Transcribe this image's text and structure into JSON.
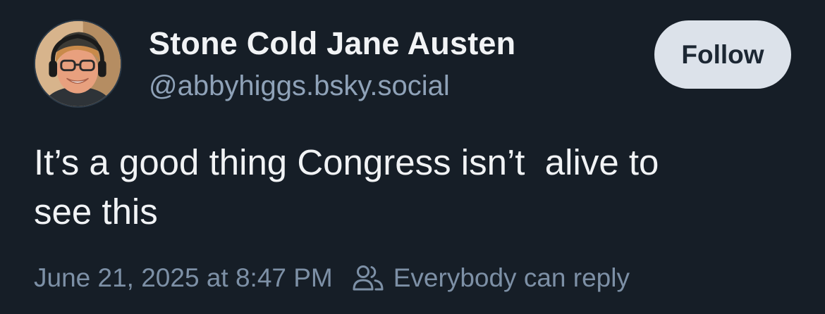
{
  "author": {
    "display_name": "Stone Cold Jane Austen",
    "handle": "@abbyhiggs.bsky.social",
    "avatar_icon": "user-avatar-photo"
  },
  "follow_button": {
    "label": "Follow"
  },
  "post": {
    "text": "It’s a good thing Congress isn’t  alive to\nsee this"
  },
  "meta": {
    "timestamp": "June 21, 2025 at 8:47 PM",
    "reply_setting": "Everybody can reply",
    "reply_icon": "people-icon"
  },
  "colors": {
    "background": "#161e27",
    "primary_text": "#f1f3f5",
    "secondary_text": "#8fa2b8",
    "meta_text": "#7d90a6",
    "follow_bg": "#dce2ea",
    "follow_text": "#1c2733"
  }
}
